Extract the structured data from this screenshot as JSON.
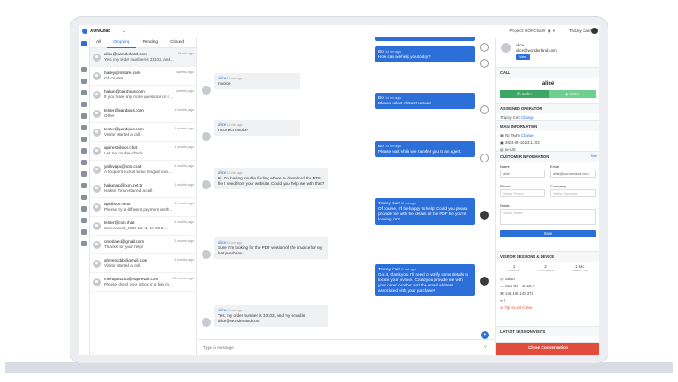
{
  "app": {
    "brand": "XONChat",
    "project_label": "Project: XONChat",
    "user_name": "Tracey Carr"
  },
  "tabs": [
    {
      "label": "All"
    },
    {
      "label": "Ongoing"
    },
    {
      "label": "Pending"
    },
    {
      "label": "Closed"
    }
  ],
  "conversations": [
    {
      "name": "alice@wonderland.com",
      "message": "Yes, my order number is 33102, and...",
      "time": "15 min ago"
    },
    {
      "name": "hailey@instare.com",
      "message": "Of course!",
      "time": "4 weeks ago"
    },
    {
      "name": "hakan@pardnius.com",
      "message": "If you have any more questions or ne...",
      "time": "4 weeks ago"
    },
    {
      "name": "tester@pardnius.com",
      "message": "Other",
      "time": "1 months ago"
    },
    {
      "name": "tester@pardnius.com",
      "message": "Visitor started a call.",
      "time": "1 months ago"
    },
    {
      "name": "apirtest@xon.chat",
      "message": "Let me double-check ...",
      "time": "1 months ago"
    },
    {
      "name": "yallovapk@xon.chat",
      "message": "A torquent luctus netus feugiat soci...",
      "time": "1 months ago"
    },
    {
      "name": "hakanapi@xon.net.tr",
      "message": "Hakan Torun started a call.",
      "time": "1 months ago"
    },
    {
      "name": "api@xon.net.tr",
      "message": "Please try a different payment meth...",
      "time": "1 months ago"
    },
    {
      "name": "tester@xon.chat",
      "message": "Screenshot_2020-12-11-10-55-3...",
      "time": "1 months ago"
    },
    {
      "name": "oneplaes@gmail.com",
      "message": "Thanks for your help!",
      "time": "2 months ago"
    },
    {
      "name": "ahmetcobb@gmail.com",
      "message": "Visitor started a call.",
      "time": "2 months ago"
    },
    {
      "name": "mehap85203@naprevolt.com",
      "message": "Please check your inbox in a few m...",
      "time": "10 months ago"
    }
  ],
  "messages": [
    {
      "dir": "out",
      "who": "Bot",
      "time": "14 min ago",
      "text": ""
    },
    {
      "dir": "out",
      "who": "Bot",
      "time": "14 min ago",
      "text": "How can we help you today?"
    },
    {
      "dir": "in",
      "who": "alice",
      "time": "14 min ago",
      "text": "Invoice"
    },
    {
      "dir": "out",
      "who": "Bot",
      "time": "14 min ago",
      "text": "Please select closest answer."
    },
    {
      "dir": "in",
      "who": "alice",
      "time": "14 min ago",
      "text": "Incorrect Invoice"
    },
    {
      "dir": "out",
      "who": "Bot",
      "time": "14 min ago",
      "text": "Please wait while we transfer you to an agent."
    },
    {
      "dir": "in",
      "who": "alice",
      "time": "13 min ago",
      "text": "Hi, I'm having trouble finding where to download the PDF file I need from your website. Could you help me with that?"
    },
    {
      "dir": "out",
      "who": "Tracey Carr",
      "time": "12 min ago",
      "text": "Of course, I'd be happy to help! Could you please provide me with the details of the PDF file you're looking for?"
    },
    {
      "dir": "in",
      "who": "alice",
      "time": "11 min ago",
      "text": "Sure, I'm looking for the PDF version of the invoice for my last purchase."
    },
    {
      "dir": "out",
      "who": "Tracey Carr",
      "time": "11 min ago",
      "text": "Got it, thank you. I'll need to verify some details to locate your invoice. Could you provide me with your order number and the email address associated with your purchase?"
    },
    {
      "dir": "in",
      "who": "alice",
      "time": "10 min ago",
      "text": "Yes, my order number is 33102, and my email is alice@wonderland.com"
    }
  ],
  "composer": {
    "placeholder": "Type a message"
  },
  "profile": {
    "name": "alice",
    "email": "alice@wonderland.com",
    "view_label": "View"
  },
  "call": {
    "title": "CALL",
    "name": "alice",
    "audio_label": "Audio",
    "video_label": "Video"
  },
  "assigned": {
    "title": "ASSIGNED OPERATOR",
    "operator": "Tracey Carr",
    "change_label": "Change"
  },
  "main_info": {
    "title": "MAIN INFORMATION",
    "team": "No Team",
    "change_label": "Change",
    "datetime": "2024-02-16 23:11:02",
    "lang": "en-US"
  },
  "customer": {
    "title": "CUSTOMER INFORMATION",
    "edit_label": "Hide",
    "name_label": "Name",
    "name_value": "alice",
    "email_label": "Email",
    "email_value": "alice@wonderland.com",
    "phone_label": "Phone",
    "phone_placeholder": "Visitor Phone",
    "company_label": "Company",
    "company_placeholder": "Visitor Company",
    "notes_label": "Notes",
    "notes_placeholder": "Visitor Notes",
    "save_label": "Save"
  },
  "sessions": {
    "title": "VISITOR SESSIONS & DEVICE",
    "stats": [
      {
        "value": "1",
        "label": "Sessions"
      },
      {
        "value": "2",
        "label": "Conversations"
      },
      {
        "value": "1 sec",
        "label": "Session Time"
      }
    ],
    "browser": "Safari",
    "os": "Mac OS - 10.15.7",
    "ip": "216.108.148.372",
    "path": "/",
    "ban": "Tap to not Active"
  },
  "latest": {
    "title": "LATEST SESSION VISITS"
  },
  "close_label": "Close Conversation",
  "colors": {
    "accent": "#2c6fd8",
    "audio": "#3ea765",
    "video": "#6fcf8e",
    "danger": "#e24c3c"
  }
}
